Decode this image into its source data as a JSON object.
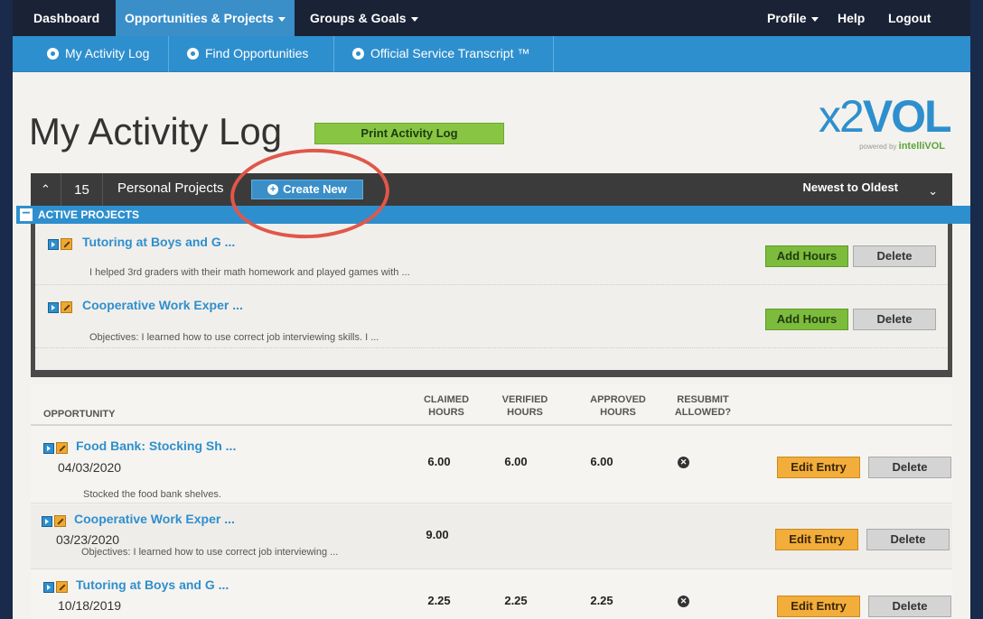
{
  "topnav": {
    "dashboard": "Dashboard",
    "opportunities": "Opportunities & Projects",
    "groups": "Groups & Goals",
    "profile": "Profile",
    "help": "Help",
    "logout": "Logout"
  },
  "subnav": {
    "activity_log": "My Activity Log",
    "find": "Find Opportunities",
    "transcript": "Official Service Transcript ™"
  },
  "page": {
    "title": "My Activity Log",
    "print_label": "Print Activity Log"
  },
  "logo": {
    "text_x2": "x2",
    "text_vol": "VOL",
    "powered": "powered by",
    "brand": "intelliVOL"
  },
  "projects": {
    "count": "15",
    "label": "Personal Projects",
    "create_label": "Create New",
    "sort_label": "Newest to Oldest",
    "active_label": "ACTIVE PROJECTS",
    "items": [
      {
        "title": "Tutoring at Boys and G ...",
        "desc": "I helped 3rd graders with their math homework and played games with ...",
        "add_label": "Add Hours",
        "delete_label": "Delete"
      },
      {
        "title": "Cooperative Work Exper ...",
        "desc": "Objectives: I learned how to use correct job interviewing skills. I ...",
        "add_label": "Add Hours",
        "delete_label": "Delete"
      }
    ]
  },
  "table": {
    "headers": {
      "opportunity": "OPPORTUNITY",
      "claimed1": "CLAIMED",
      "claimed2": "HOURS",
      "verified1": "VERIFIED",
      "verified2": "HOURS",
      "approved1": "APPROVED",
      "approved2": "HOURS",
      "resubmit1": "RESUBMIT",
      "resubmit2": "ALLOWED?"
    },
    "rows": [
      {
        "title": "Food Bank: Stocking Sh ...",
        "date": "04/03/2020",
        "desc": "Stocked the food bank shelves.",
        "claimed": "6.00",
        "verified": "6.00",
        "approved": "6.00",
        "resubmit_icon": "x-circle-icon",
        "edit_label": "Edit Entry",
        "delete_label": "Delete"
      },
      {
        "title": "Cooperative Work Exper ...",
        "date": "03/23/2020",
        "desc": "Objectives: I learned how to use correct job interviewing ...",
        "claimed": "9.00",
        "verified": "",
        "approved": "",
        "edit_label": "Edit Entry",
        "delete_label": "Delete"
      },
      {
        "title": "Tutoring at Boys and G ...",
        "date": "10/18/2019",
        "desc": "",
        "claimed": "2.25",
        "verified": "2.25",
        "approved": "2.25",
        "resubmit_icon": "x-circle-icon",
        "edit_label": "Edit Entry",
        "delete_label": "Delete"
      }
    ]
  },
  "colors": {
    "accent_blue": "#2e8fce",
    "green": "#88c543",
    "orange": "#f2ad3b",
    "annotation": "#e0574a"
  }
}
